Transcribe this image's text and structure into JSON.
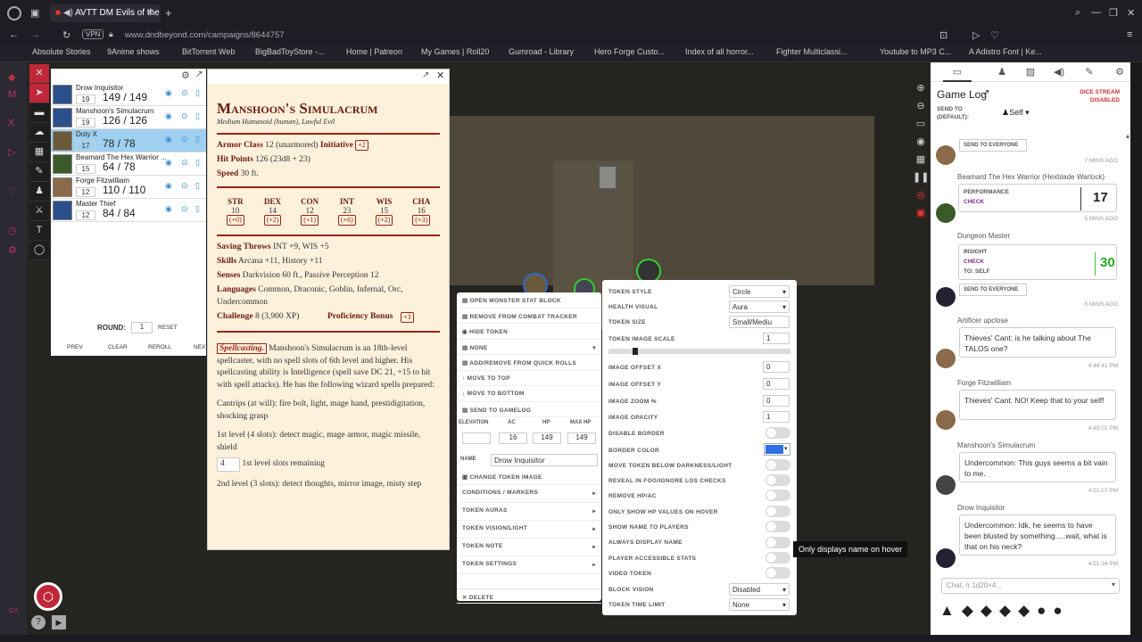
{
  "browser": {
    "tab_title": "AVTT DM Evils of the V",
    "vpn": "VPN",
    "url": "www.dndbeyond.com/campaigns/8644757",
    "bookmarks": [
      "Absolute Stories",
      "9Anime shows",
      "BitTorrent Web",
      "BigBadToyStore -...",
      "Home | Patreon",
      "My Games | Roll20",
      "Gumroad - Library",
      "Hero Forge Custo...",
      "Index of all horror...",
      "Fighter Multiclassi...",
      "Youtube to MP3 C...",
      "A Adistro Font | Ke..."
    ]
  },
  "combat": {
    "rows": [
      {
        "name": "Drow Inquisitor",
        "init": "19",
        "hp": "149",
        "max": "149",
        "selected": false
      },
      {
        "name": "Manshoon's Simulacrum",
        "init": "19",
        "hp": "126",
        "max": "126",
        "selected": false
      },
      {
        "name": "Doty X",
        "init": "17",
        "hp": "78",
        "max": "78",
        "selected": true
      },
      {
        "name": "Beamard The Hex Warrior ...",
        "init": "15",
        "hp": "64",
        "max": "78",
        "selected": false
      },
      {
        "name": "Forge Fitzwilliam",
        "init": "12",
        "hp": "110",
        "max": "110",
        "selected": false
      },
      {
        "name": "Master Thief",
        "init": "12",
        "hp": "84",
        "max": "84",
        "selected": false
      }
    ],
    "round_label": "ROUND:",
    "round": "1",
    "reset": "RESET",
    "prev": "PREV",
    "clear": "CLEAR",
    "reroll": "REROLL",
    "next": "NEXT"
  },
  "stat": {
    "name": "Manshoon's Simulacrum",
    "meta": "Medium Humanoid (human), Lawful Evil",
    "ac_label": "Armor Class",
    "ac": "12",
    "ac_note": "(unarmored)",
    "init_label": "Initiative",
    "init": "+2",
    "hp_label": "Hit Points",
    "hp": "126",
    "hp_note": "(23d8 + 23)",
    "speed_label": "Speed",
    "speed": "30 ft.",
    "abilities": [
      {
        "k": "STR",
        "v": "10",
        "m": "(+0)"
      },
      {
        "k": "DEX",
        "v": "14",
        "m": "(+2)"
      },
      {
        "k": "CON",
        "v": "12",
        "m": "(+1)"
      },
      {
        "k": "INT",
        "v": "23",
        "m": "(+6)"
      },
      {
        "k": "WIS",
        "v": "15",
        "m": "(+2)"
      },
      {
        "k": "CHA",
        "v": "16",
        "m": "(+3)"
      }
    ],
    "saves_label": "Saving Throws",
    "saves": "INT +9, WIS +5",
    "skills_label": "Skills",
    "skills": "Arcana +11, History +11",
    "senses_label": "Senses",
    "senses": "Darkvision 60 ft., Passive Perception 12",
    "lang_label": "Languages",
    "lang": "Common, Draconic, Goblin, Infernal, Orc, Undercommon",
    "chal_label": "Challenge",
    "chal": "8 (3,900 XP)",
    "prof_label": "Proficiency Bonus",
    "prof": "+3",
    "spell_title": "Spellcasting.",
    "spell_text": "Manshoon's Simulacrum is an 18th-level spellcaster, with no spell slots of 6th level and higher. His spellcasting ability is Intelligence (spell save DC 21, +15 to hit with spell attacks). He has the following wizard spells prepared:",
    "cantrips": "Cantrips (at will): fire bolt, light, mage hand, prestidigitation, shocking grasp",
    "lvl1": "1st level (4 slots): detect magic, mage armor, magic missile, shield",
    "slots_val": "4",
    "slots_label": "1st level slots remaining",
    "lvl2": "2nd level (3 slots): detect thoughts, mirror image, misty step"
  },
  "menu": {
    "items": [
      "OPEN MONSTER STAT BLOCK",
      "REMOVE FROM COMBAT TRACKER",
      "HIDE TOKEN",
      "NONE",
      "ADD/REMOVE FROM QUICK ROLLS",
      "MOVE TO TOP",
      "MOVE TO BOTTOM",
      "SEND TO GAMELOG"
    ],
    "elev": "ELEVATION",
    "ac": "AC",
    "hp": "HP",
    "maxhp": "MAX HP",
    "ac_val": "16",
    "hp_val": "149",
    "maxhp_val": "149",
    "name_label": "NAME",
    "name_val": "Drow Inquisitor",
    "change_img": "CHANGE TOKEN IMAGE",
    "subs": [
      "CONDITIONS / MARKERS",
      "TOKEN AURAS",
      "TOKEN VISION/LIGHT",
      "TOKEN NOTE",
      "TOKEN SETTINGS"
    ],
    "delete": "DELETE"
  },
  "settings": {
    "style_label": "TOKEN STYLE",
    "style": "Circle",
    "health_label": "HEALTH VISUAL",
    "health": "Aura",
    "size_label": "TOKEN SIZE",
    "size": "Small/Mediu",
    "scale_label": "TOKEN IMAGE SCALE",
    "scale": "1",
    "offx_label": "IMAGE OFFSET X",
    "offx": "0",
    "offy_label": "IMAGE OFFSET Y",
    "offy": "0",
    "zoom_label": "IMAGE ZOOM %",
    "zoom": "0",
    "opac_label": "IMAGE OPACITY",
    "opac": "1",
    "toggles": [
      "DISABLE BORDER",
      "BORDER COLOR",
      "MOVE TOKEN BELOW DARKNESS/LIGHT",
      "REVEAL IN FOG/IGNORE LOS CHECKS",
      "REMOVE HP/AC",
      "ONLY SHOW HP VALUES ON HOVER",
      "SHOW NAME TO PLAYERS",
      "ALWAYS DISPLAY NAME",
      "PLAYER ACCESSIBLE STATS",
      "VIDEO TOKEN"
    ],
    "block_label": "BLOCK VISION",
    "block": "Disabled",
    "limit_label": "TOKEN TIME LIMIT",
    "limit": "None",
    "border_color": "#2f6fe8"
  },
  "tooltip": "Only displays name on hover",
  "log": {
    "title": "Game Log",
    "send_to": "SEND TO (DEFAULT):",
    "self": "Self",
    "dice_stream": "DICE STREAM DISABLED",
    "send_everyone": "SEND TO EVERYONE",
    "t1": "7 MINS AGO",
    "m1_name": "Beamard The Hex Warrior (Hexblade Warlock)",
    "m1_l1": "PERFORMANCE",
    "m1_l2": "CHECK",
    "m1_val": "17",
    "t2": "5 MINS AGO",
    "m2_name": "Dungeon Master",
    "m2_l1": "INSIGHT",
    "m2_l2": "CHECK",
    "m2_l3": "TO: SELF",
    "m2_val": "30",
    "t3": "5 MINS AGO",
    "m3_name": "Artificer upclose",
    "m3_text": "Thieves' Cant: is he talking about The TALOS one?",
    "t4": "4:48:41 PM",
    "m4_name": "Forge Fitzwilliam",
    "m4_text": "Thieves' Cant: NO! Keep that to your self!",
    "t5": "4:49:01 PM",
    "m5_name": "Manshoon's Simulacrum",
    "m5_text": "Undercommon: This guys seems a bit vain to me.",
    "t6": "4:51:07 PM",
    "m6_name": "Drow Inquisitor",
    "m6_text": "Undercommon: Idk, he seems to have been blusted by something.....wait, what is that on his neck?",
    "t7": "4:51:34 PM",
    "chat_placeholder": "Chat, /r 1d20+4..."
  }
}
